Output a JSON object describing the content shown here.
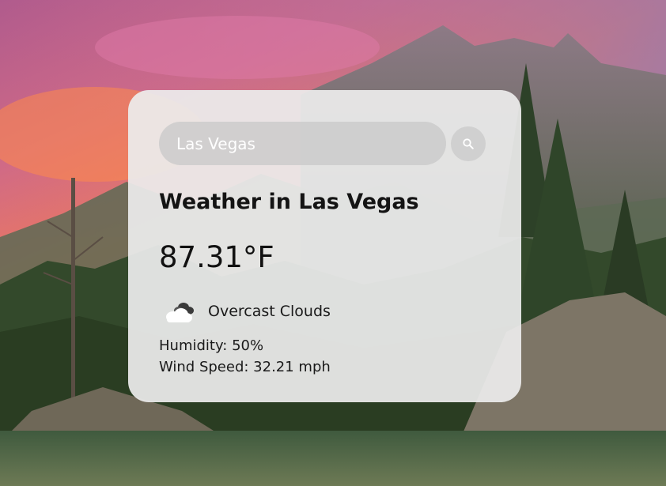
{
  "search": {
    "value": "Las Vegas",
    "button_icon": "search-icon"
  },
  "weather": {
    "title": "Weather in Las Vegas",
    "temperature": "87.31°F",
    "condition_icon": "overcast-clouds-icon",
    "condition": "Overcast Clouds",
    "humidity": "Humidity: 50%",
    "wind": "Wind Speed: 32.21 mph"
  },
  "background": {
    "description_icon": "mountain-lake-background"
  },
  "colors": {
    "card": "#ececec",
    "input": "#c8c8c8",
    "text": "#141414"
  }
}
